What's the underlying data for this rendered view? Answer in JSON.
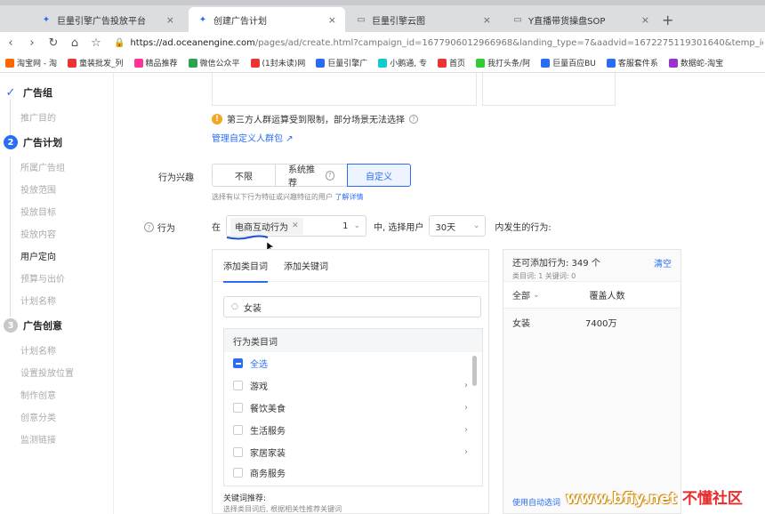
{
  "browser": {
    "tabs": [
      {
        "label": "巨量引擎广告投放平台",
        "icon": "oceanengine-icon"
      },
      {
        "label": "创建广告计划",
        "icon": "oceanengine-icon"
      },
      {
        "label": "巨量引擎云图",
        "icon": "doc-icon"
      },
      {
        "label": "Y直播带货操盘SOP",
        "icon": "doc-icon"
      }
    ],
    "url_host": "https://ad.oceanengine.com",
    "url_path": "/pages/ad/create.html?campaign_id=1677906012966968&landing_type=7&aadvid=1672275119301640&temp_id=...",
    "bookmarks": [
      {
        "label": "淘宝网 - 淘",
        "color": "#f60"
      },
      {
        "label": "童装批发_列",
        "color": "#e33"
      },
      {
        "label": "精品推荐",
        "color": "#f39"
      },
      {
        "label": "微信公众平",
        "color": "#2ba24c"
      },
      {
        "label": "(1封未读)网",
        "color": "#e33"
      },
      {
        "label": "巨量引擎广",
        "color": "#2a6df4"
      },
      {
        "label": "小鹅通, 专",
        "color": "#1cc"
      },
      {
        "label": "首页",
        "color": "#e33"
      },
      {
        "label": "我打头条/阿",
        "color": "#3c3"
      },
      {
        "label": "巨量百应BU",
        "color": "#2a6df4"
      },
      {
        "label": "客服套件系",
        "color": "#2a6df4"
      },
      {
        "label": "数据蛇-淘宝",
        "color": "#93c"
      }
    ]
  },
  "sidebar": {
    "steps": [
      {
        "label": "广告组",
        "marker": "✓"
      },
      {
        "label": "广告计划",
        "marker": "2"
      },
      {
        "label": "广告创意",
        "marker": "3"
      }
    ],
    "group_items": [
      "推广目的"
    ],
    "plan_items": [
      "所属广告组",
      "投放范围",
      "投放目标",
      "投放内容",
      "用户定向",
      "预算与出价",
      "计划名称"
    ],
    "creative_items": [
      "计划名称",
      "设置投放位置",
      "制作创意",
      "创意分类",
      "监测链接"
    ]
  },
  "main": {
    "warning_text": "第三方人群运算受到限制，部分场景无法选择",
    "manage_link": "管理自定义人群包",
    "interest_label": "行为兴趣",
    "segments": [
      "不限",
      "系统推荐",
      "自定义"
    ],
    "hint_text": "选择有以下行为特征或兴趣特征的用户",
    "hint_link": "了解详情",
    "behavior_label": "行为",
    "in_word": "在",
    "behavior_tag": "电商互动行为",
    "count_value": "1",
    "middle_text": "中, 选择用户",
    "days_value": "30天",
    "after_text": "内发生的行为:",
    "panel": {
      "tab_category": "添加类目词",
      "tab_keyword": "添加关键词",
      "search_value": "女装",
      "category_header": "行为类目词",
      "select_all": "全选",
      "categories": [
        "游戏",
        "餐饮美食",
        "生活服务",
        "家居家装",
        "商务服务"
      ],
      "kw_title": "关键词推荐:",
      "kw_hint": "选择类目词后, 根据相关性推荐关键词"
    },
    "right_panel": {
      "title": "还可添加行为: 349 个",
      "sub": "类目词: 1    关键词: 0",
      "clear": "清空",
      "col_all": "全部",
      "col_cover": "覆盖人数",
      "rows": [
        {
          "name": "女装",
          "cover": "7400万"
        }
      ],
      "footer": "使用自动选词"
    }
  },
  "watermark": {
    "part1": "www.bfiy.net",
    "part2": "不懂社区"
  }
}
